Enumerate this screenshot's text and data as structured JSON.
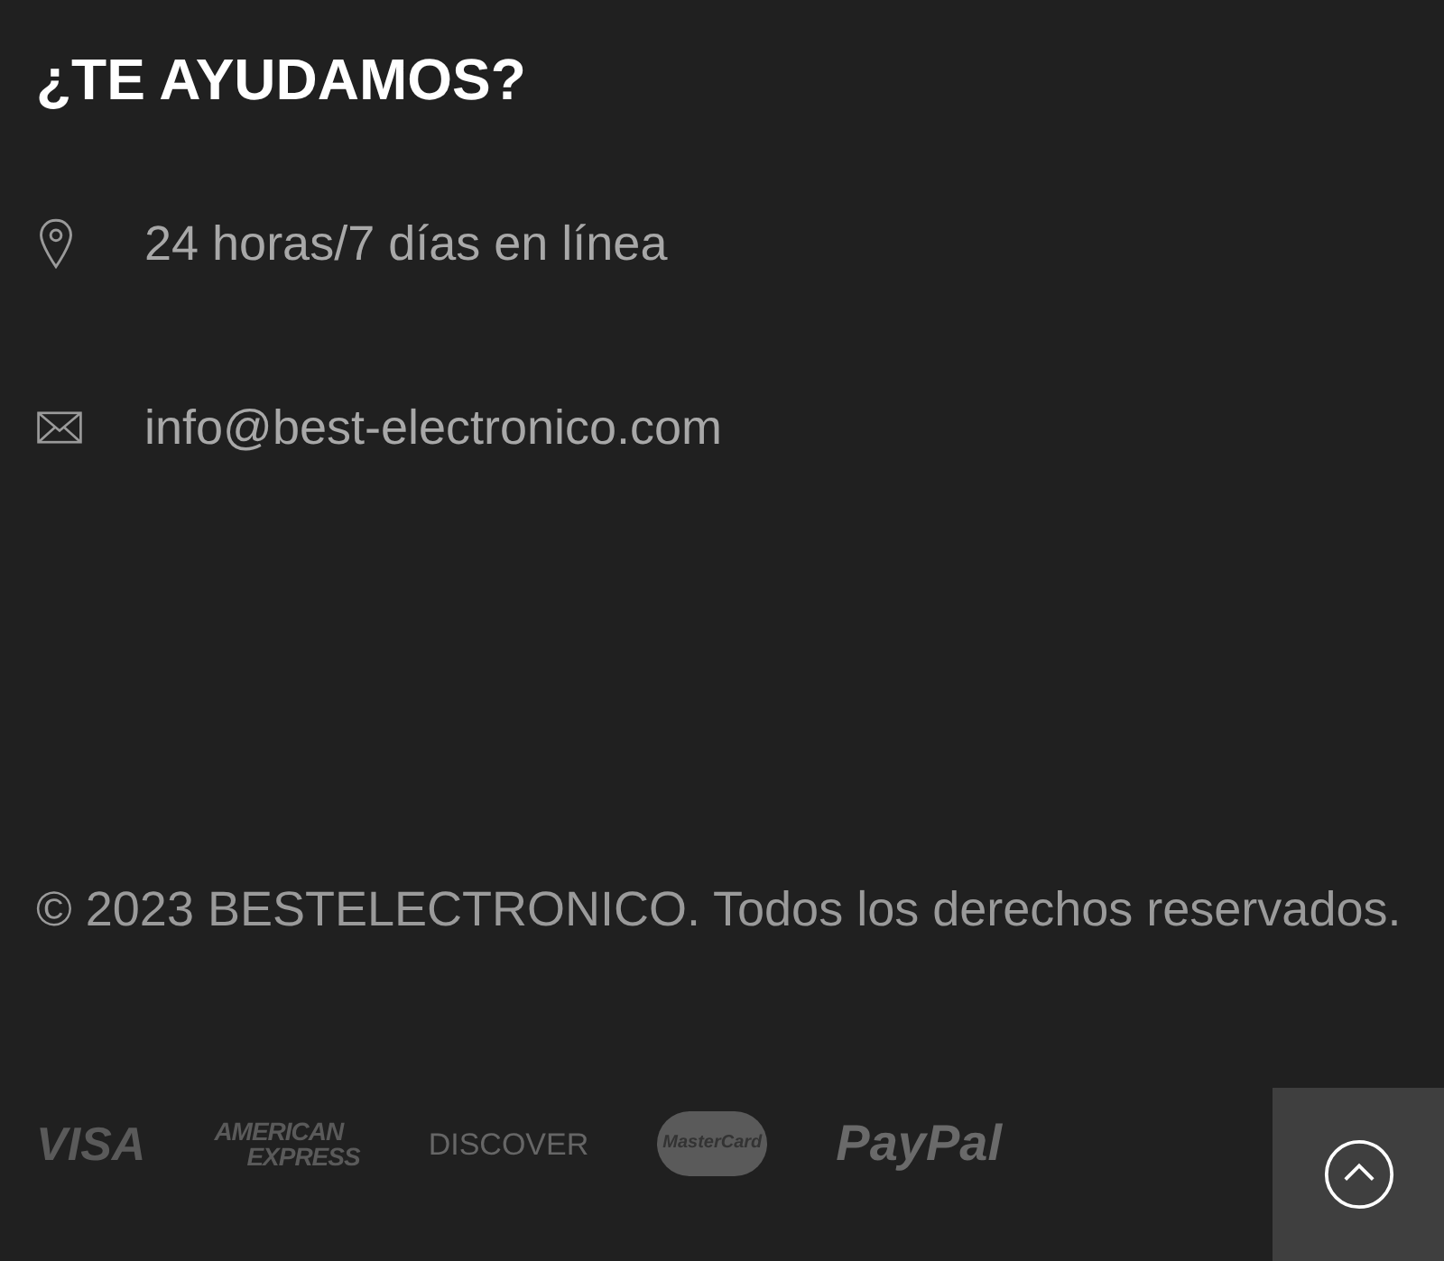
{
  "heading": "¿TE AYUDAMOS?",
  "contacts": [
    {
      "kind": "location",
      "text": "24 horas/7 días en línea"
    },
    {
      "kind": "email",
      "text": "info@best-electronico.com"
    }
  ],
  "copyright": "© 2023 BESTELECTRONICO. Todos los derechos reservados.",
  "payment_logos": [
    {
      "kind": "visa",
      "lines": [
        "VISA"
      ]
    },
    {
      "kind": "amex",
      "lines": [
        "AMERICAN",
        "EXPRESS"
      ]
    },
    {
      "kind": "discover",
      "lines": [
        "DISCOVER"
      ]
    },
    {
      "kind": "mastercard",
      "lines": [
        "MasterCard"
      ]
    },
    {
      "kind": "paypal",
      "lines": [
        "PayPal"
      ]
    }
  ]
}
